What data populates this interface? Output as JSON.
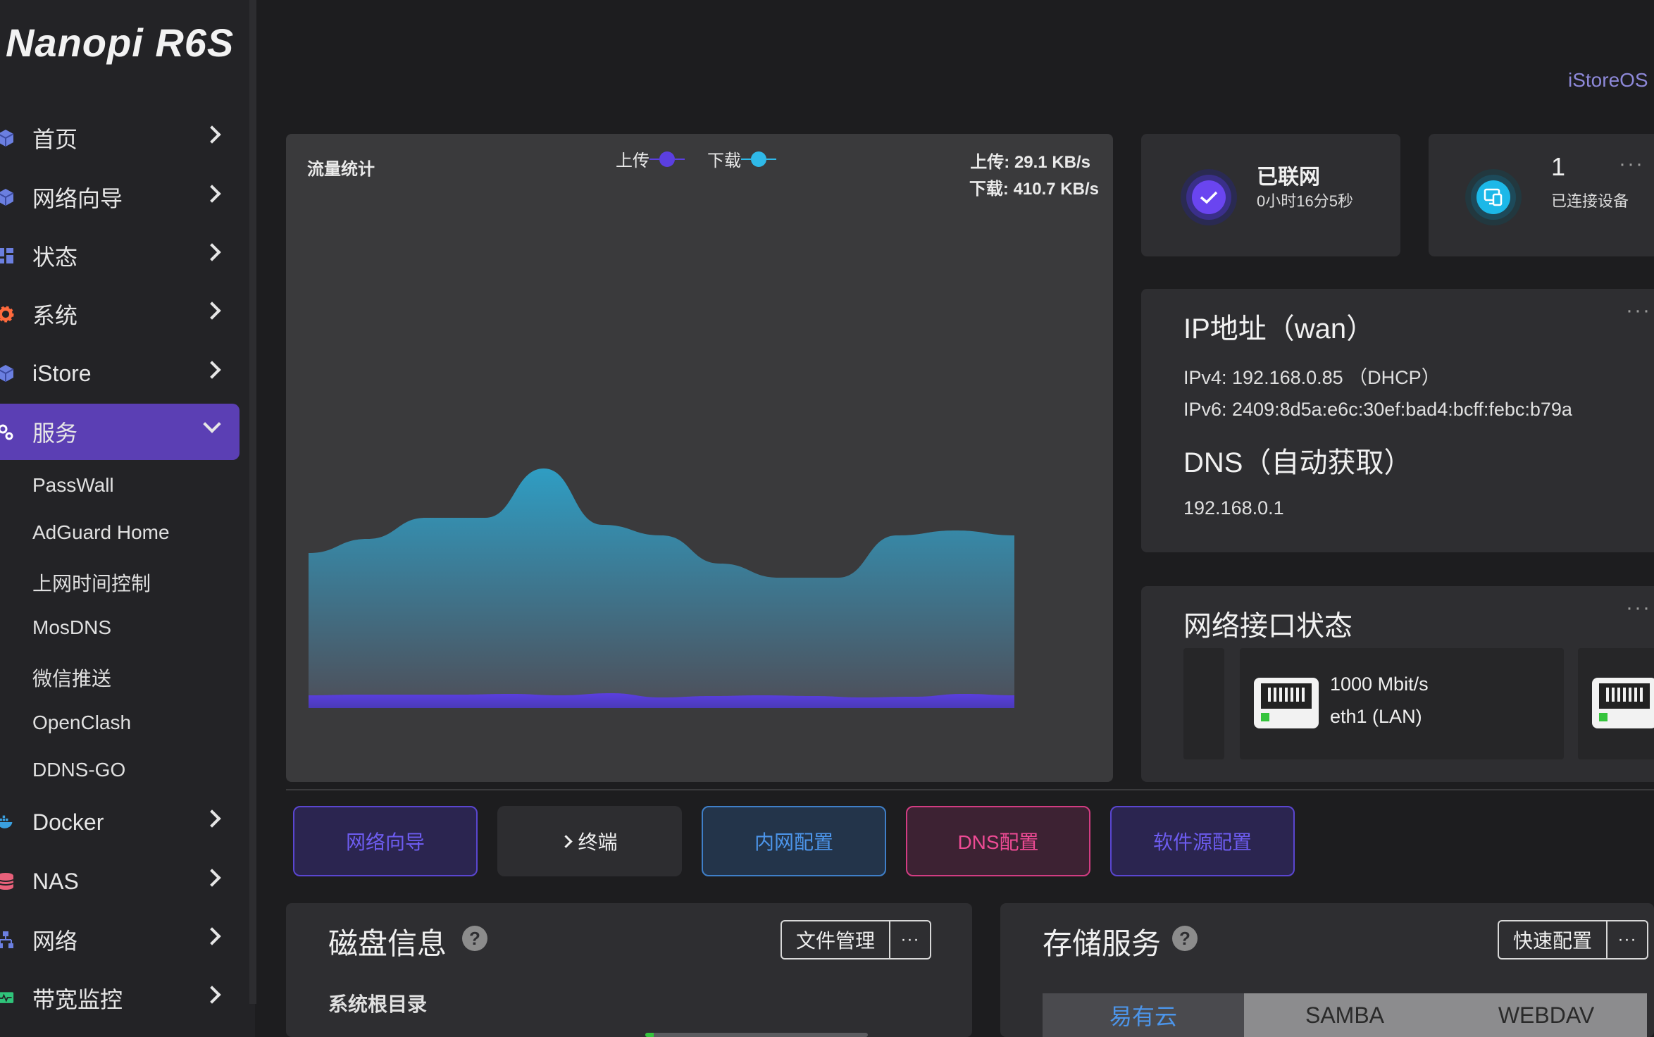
{
  "brand": "Nanopi R6S",
  "header_link": "iStoreOS",
  "sidebar": {
    "items": [
      {
        "label": "首页"
      },
      {
        "label": "网络向导"
      },
      {
        "label": "状态"
      },
      {
        "label": "系统"
      },
      {
        "label": "iStore"
      },
      {
        "label": "服务"
      },
      {
        "label": "Docker"
      },
      {
        "label": "NAS"
      },
      {
        "label": "网络"
      },
      {
        "label": "带宽监控"
      }
    ],
    "service_submenu": [
      "PassWall",
      "AdGuard Home",
      "上网时间控制",
      "MosDNS",
      "微信推送",
      "OpenClash",
      "DDNS-GO"
    ]
  },
  "traffic": {
    "title": "流量统计",
    "legend_upload": "上传",
    "legend_download": "下载",
    "upload_rate": "上传: 29.1 KB/s",
    "download_rate": "下载: 410.7 KB/s",
    "colors": {
      "upload": "#5b3fe0",
      "download": "#2fb9e8"
    }
  },
  "chart_data": {
    "type": "area",
    "title": "流量统计",
    "series": [
      {
        "name": "上传",
        "values": [
          18,
          19,
          19,
          19,
          20,
          18,
          21,
          15,
          17,
          18,
          17,
          15,
          16,
          20,
          18
        ]
      },
      {
        "name": "下载",
        "values": [
          220,
          240,
          270,
          270,
          340,
          260,
          245,
          205,
          185,
          185,
          245,
          252,
          245
        ]
      }
    ]
  },
  "connection": {
    "status": "已联网",
    "uptime": "0小时16分5秒",
    "devices_count": "1",
    "devices_label": "已连接设备",
    "more": "···"
  },
  "ip": {
    "title": "IP地址（wan）",
    "ipv4": "IPv4: 192.168.0.85 （DHCP）",
    "ipv6": "IPv6: 2409:8d5a:e6c:30ef:bad4:bcff:febc:b79a",
    "dns_title": "DNS（自动获取）",
    "dns": "192.168.0.1"
  },
  "interfaces": {
    "title": "网络接口状态",
    "items": [
      {
        "speed": "1000 Mbit/s",
        "name": "eth1 (LAN)"
      }
    ]
  },
  "quick_buttons": [
    {
      "label": "网络向导"
    },
    {
      "label": "终端"
    },
    {
      "label": "内网配置"
    },
    {
      "label": "DNS配置"
    },
    {
      "label": "软件源配置"
    }
  ],
  "disk": {
    "title": "磁盘信息",
    "button": "文件管理",
    "section": "系统根目录"
  },
  "storage": {
    "title": "存储服务",
    "button": "快速配置",
    "tabs": [
      "易有云",
      "SAMBA",
      "WEBDAV"
    ]
  }
}
